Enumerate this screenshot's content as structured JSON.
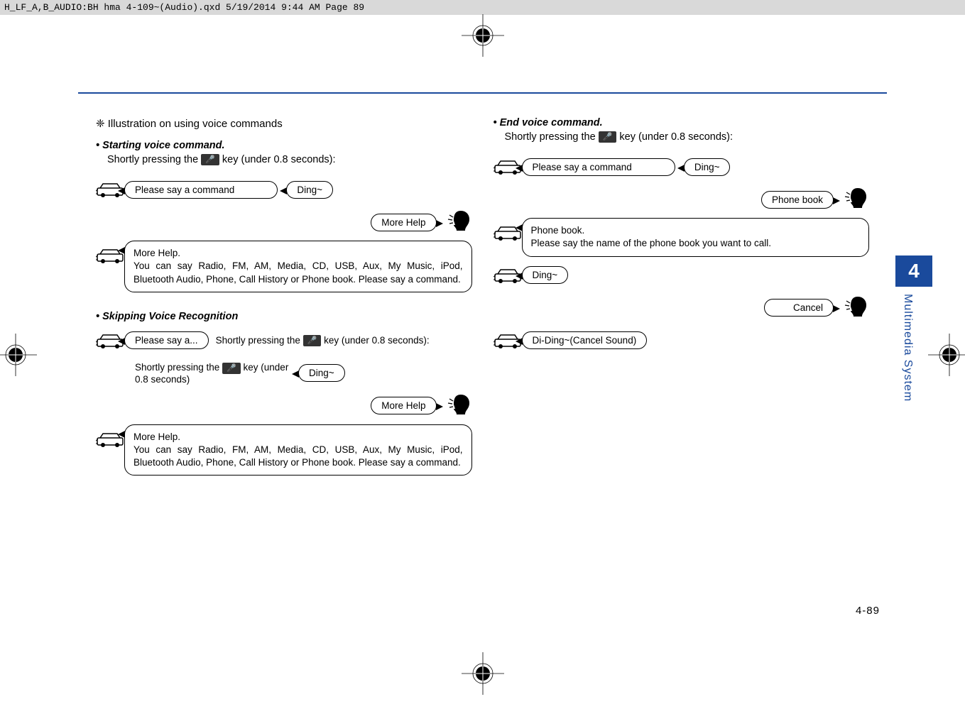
{
  "header_strip": "H_LF_A,B_AUDIO:BH hma 4-109~(Audio).qxd  5/19/2014  9:44 AM  Page 89",
  "side_tab": {
    "num": "4",
    "label": "Multimedia System"
  },
  "page_num": "4-89",
  "left": {
    "title": "❈ Illustration on using voice commands",
    "start_head": "• Starting voice command.",
    "start_instr_a": "Shortly pressing the ",
    "start_instr_b": " key (under 0.8 seconds):",
    "say_cmd": "Please say a command",
    "ding": "Ding~",
    "more_help": "More Help",
    "more_help_block_title": "More Help.",
    "more_help_block_body": "You can say Radio, FM, AM, Media, CD, USB, Aux, My Music, iPod, Bluetooth Audio, Phone, Call History or Phone book. Please say a command.",
    "skip_head": "• Skipping Voice Recognition",
    "say_a": "Please say a...",
    "skip_instr1a": "Shortly pressing the ",
    "skip_instr1b": " key (under 0.8 seconds):",
    "skip_instr2a": "Shortly pressing the ",
    "skip_instr2b": " key (under 0.8 seconds)",
    "voice_key": "🎤"
  },
  "right": {
    "end_head": "• End voice command.",
    "end_instr_a": "Shortly pressing the ",
    "end_instr_b": " key (under 0.8 seconds):",
    "say_cmd": "Please say a command",
    "ding": "Ding~",
    "phone_book": "Phone book",
    "pb_block_title": "Phone book.",
    "pb_block_body": "Please say the name of the phone book you want to call.",
    "ding2": "Ding~",
    "cancel": "Cancel",
    "cancel_sound": "Di-Ding~(Cancel Sound)",
    "voice_key": "🎤"
  }
}
